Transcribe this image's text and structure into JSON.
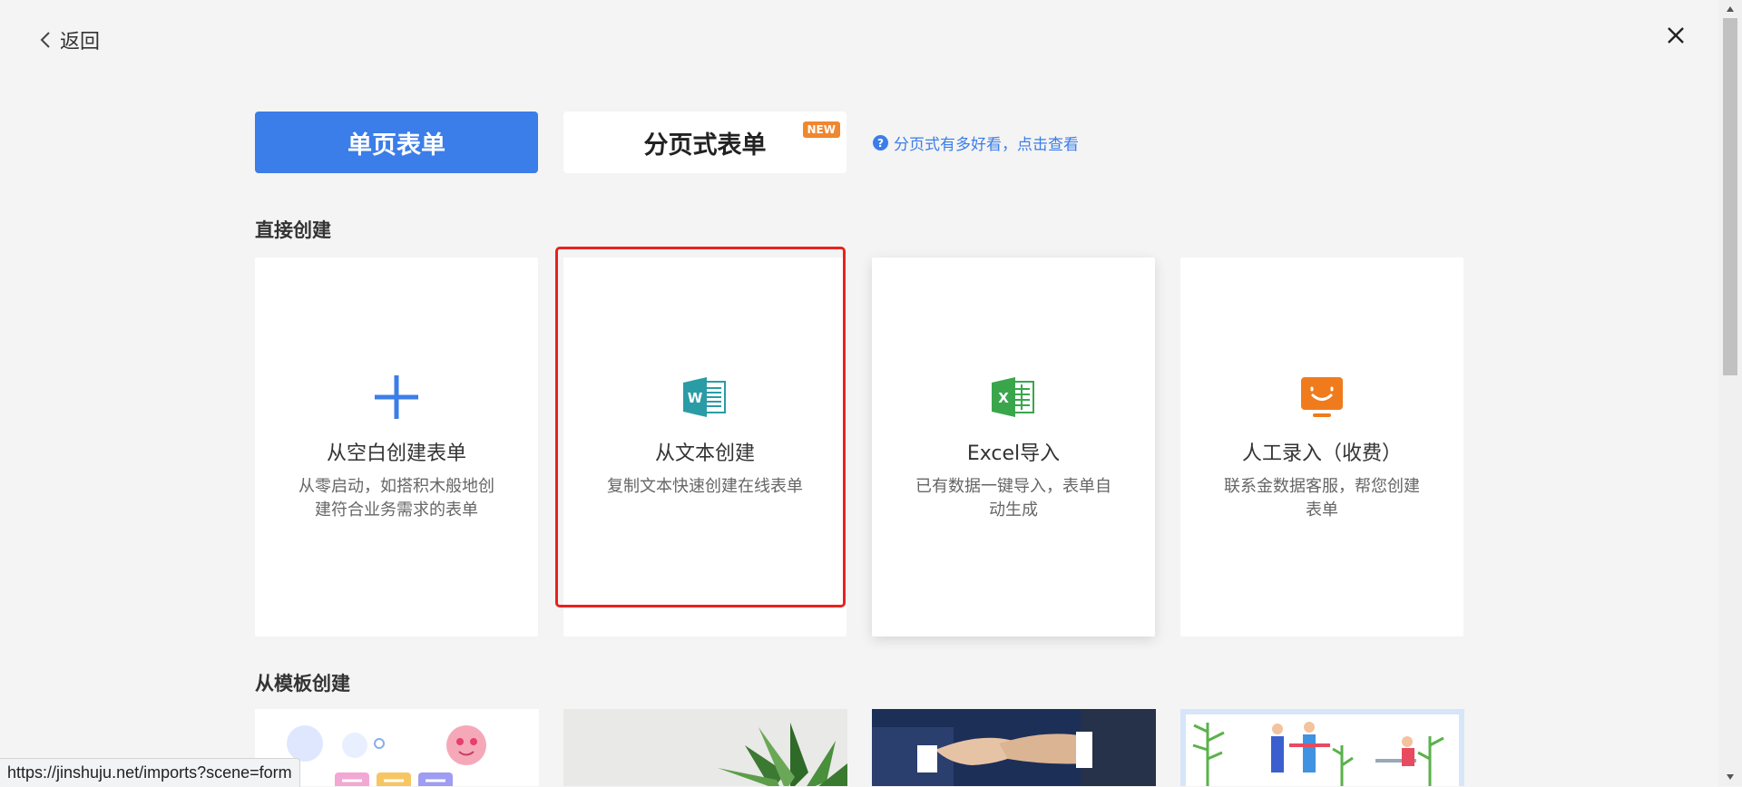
{
  "header": {
    "back_label": "返回"
  },
  "mode_tabs": {
    "single": "单页表单",
    "paged": "分页式表单",
    "new_badge": "NEW",
    "help_icon": "?",
    "help_link": "分页式有多好看，点击查看"
  },
  "sections": {
    "direct": "直接创建",
    "template": "从模板创建"
  },
  "cards": [
    {
      "icon": "plus-icon",
      "title": "从空白创建表单",
      "desc": "从零启动，如搭积木般地创建符合业务需求的表单"
    },
    {
      "icon": "word-icon",
      "title": "从文本创建",
      "desc": "复制文本快速创建在线表单"
    },
    {
      "icon": "excel-icon",
      "title": "Excel导入",
      "desc": "已有数据一键导入，表单自动生成"
    },
    {
      "icon": "monitor-smile-icon",
      "title": "人工录入（收费）",
      "desc": "联系金数据客服，帮您创建表单"
    }
  ],
  "status_url": "https://jinshuju.net/imports?scene=form",
  "colors": {
    "primary": "#3b7de9",
    "badge": "#f0862e",
    "highlight": "#e8221e",
    "word": "#2a9ca6",
    "excel": "#3aa64c",
    "manual": "#f07b1d"
  }
}
